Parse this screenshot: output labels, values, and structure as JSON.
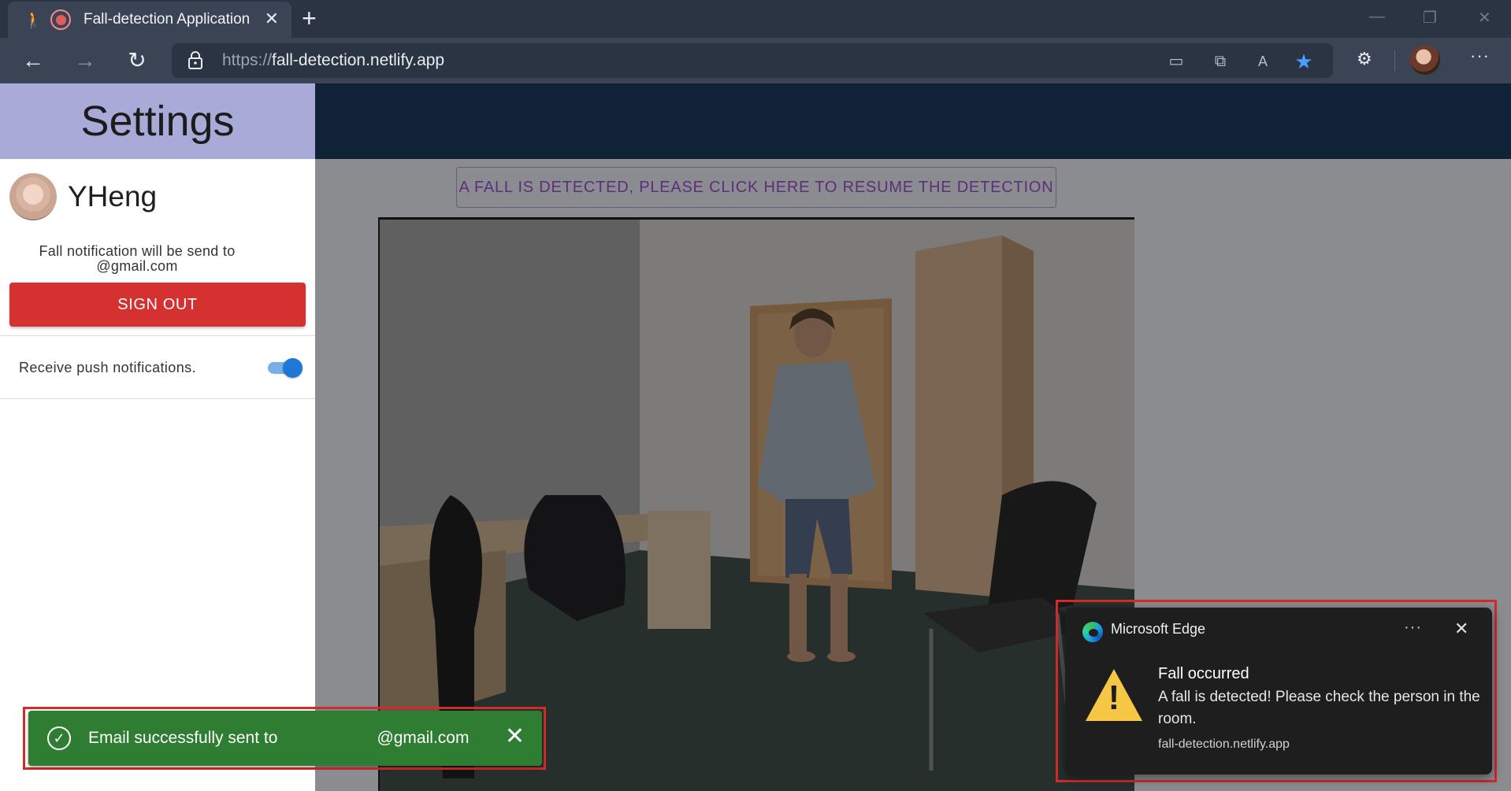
{
  "browser": {
    "tab_title": "Fall-detection Application",
    "url_protocol": "https://",
    "url_host": "fall-detection.netlify.app"
  },
  "sidebar": {
    "title": "Settings",
    "username": "YHeng",
    "notification_text": "Fall notification will be send to @gmail.com",
    "sign_out_label": "SIGN OUT",
    "push_label": "Receive push notifications.",
    "push_enabled": true,
    "sign_out_color": "#d63131"
  },
  "main": {
    "resume_label": "A FALL IS DETECTED, PLEASE CLICK HERE TO RESUME THE DETECTION",
    "topbar_color": "#0f2238"
  },
  "toast": {
    "message_prefix": "Email successfully sent to",
    "message_suffix": "@gmail.com",
    "color": "#2e7d32"
  },
  "edge_notification": {
    "app_name": "Microsoft Edge",
    "title": "Fall occurred",
    "body": "A fall is detected! Please check the person in the room.",
    "source": "fall-detection.netlify.app",
    "more_label": "···"
  },
  "icons": {
    "walker": "🚶",
    "close": "✕",
    "new_tab": "+",
    "back": "←",
    "forward": "→",
    "reload": "↻",
    "check": "✓",
    "warning": "!"
  }
}
